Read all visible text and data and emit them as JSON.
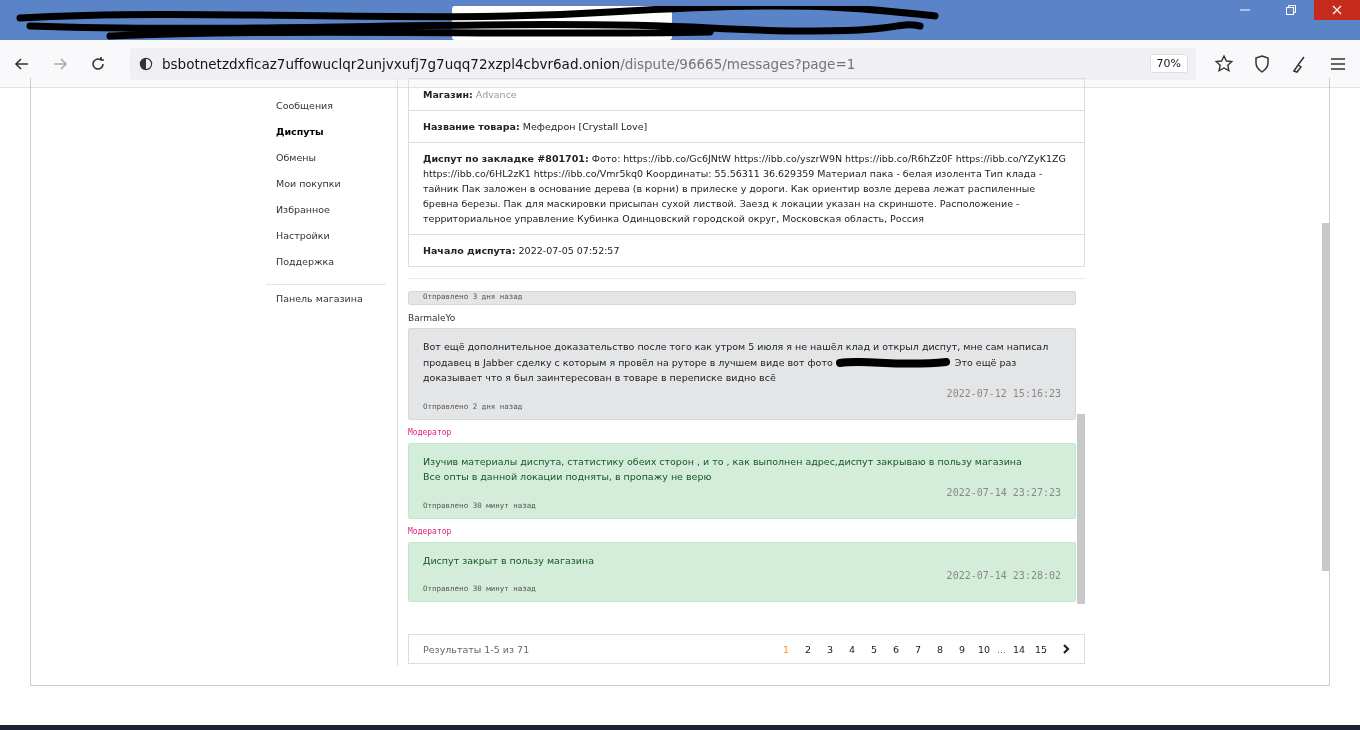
{
  "browser": {
    "url_host": "bsbotnetzdxficaz7uffowuclqr2unjvxufj7g7uqq72xzpl4cbvr6ad.onion",
    "url_path": "/dispute/96665/messages?page=1",
    "zoom": "70%"
  },
  "sidebar": {
    "items": [
      {
        "label": "Сообщения",
        "selected": false
      },
      {
        "label": "Диспуты",
        "selected": true
      },
      {
        "label": "Обмены",
        "selected": false
      },
      {
        "label": "Мои покупки",
        "selected": false
      },
      {
        "label": "Избранное",
        "selected": false
      },
      {
        "label": "Настройки",
        "selected": false
      },
      {
        "label": "Поддержка",
        "selected": false
      }
    ],
    "footer_item": "Панель магазина"
  },
  "dispute": {
    "fields": [
      {
        "label": "Магазин:",
        "value": "Advance",
        "muted": true
      },
      {
        "label": "Название товара:",
        "value": "Мефедрон [Crystall Love]",
        "muted": false
      },
      {
        "label": "Диспут по закладке #801701:",
        "value": "Фото: https://ibb.co/Gc6JNtW https://ibb.co/yszrW9N https://ibb.co/R6hZz0F https://ibb.co/YZyK1ZG https://ibb.co/6HL2zK1 https://ibb.co/Vmr5kq0 Координаты: 55.56311 36.629359 Материал пака - белая изолента Тип клада - тайник Пак заложен в основание дерева (в корни) в прилеске у дороги. Как ориентир возле дерева лежат распиленные бревна березы. Пак для маскировки присыпан сухой листвой. Заезд к локации указан на скриншоте. Расположение - территориальное управление Кубинка Одинцовский городской округ, Московская область, Россия",
        "muted": false
      },
      {
        "label": "Начало диспута:",
        "value": "2022-07-05 07:52:57",
        "muted": false
      }
    ]
  },
  "messages": [
    {
      "kind": "user",
      "sent": "Отправлено 3 дня назад"
    },
    {
      "kind": "user",
      "author": "BarmaleYo",
      "segments": [
        {
          "kind": "text",
          "text": "Вот ещё дополнительное доказательство после того как утром 5 июля я не нашёл клад и открыл диспут, мне сам написал продавец в Jabber сделку с которым я провёл на руторе в лучшем виде вот фото"
        },
        {
          "kind": "redaction"
        },
        {
          "kind": "text",
          "text": "Это ещё раз доказывает что я был заинтересован в товаре в переписке видно всё"
        }
      ],
      "timestamp": "2022-07-12 15:16:23",
      "sent": "Отправлено 2 дня назад"
    },
    {
      "kind": "moderator",
      "author": "Модератор",
      "segments": [
        {
          "kind": "text",
          "text": "Изучив материалы диспута, статистику обеих сторон , и то , как выполнен адрес,диспут закрываю в пользу магазина"
        },
        {
          "kind": "break"
        },
        {
          "kind": "text",
          "text": "Все опты в данной локации подняты, в пропажу не верю"
        }
      ],
      "timestamp": "2022-07-14 23:27:23",
      "sent": "Отправлено 30 минут назад"
    },
    {
      "kind": "moderator",
      "author": "Модератор",
      "segments": [
        {
          "kind": "text",
          "text": "Диспут закрыт в пользу магазина"
        }
      ],
      "timestamp": "2022-07-14 23:28:02",
      "sent": "Отправлено 30 минут назад"
    }
  ],
  "pagination": {
    "summary": "Результаты 1-5 из 71",
    "pages": [
      {
        "label": "1",
        "selected": true
      },
      {
        "label": "2",
        "selected": false
      },
      {
        "label": "3",
        "selected": false
      },
      {
        "label": "4",
        "selected": false
      },
      {
        "label": "5",
        "selected": false
      },
      {
        "label": "6",
        "selected": false
      },
      {
        "label": "7",
        "selected": false
      },
      {
        "label": "8",
        "selected": false
      },
      {
        "label": "9",
        "selected": false
      },
      {
        "label": "10",
        "selected": false
      },
      {
        "label": "...",
        "kind": "ellipsis"
      },
      {
        "label": "14",
        "selected": false
      },
      {
        "label": "15",
        "selected": false
      }
    ]
  }
}
